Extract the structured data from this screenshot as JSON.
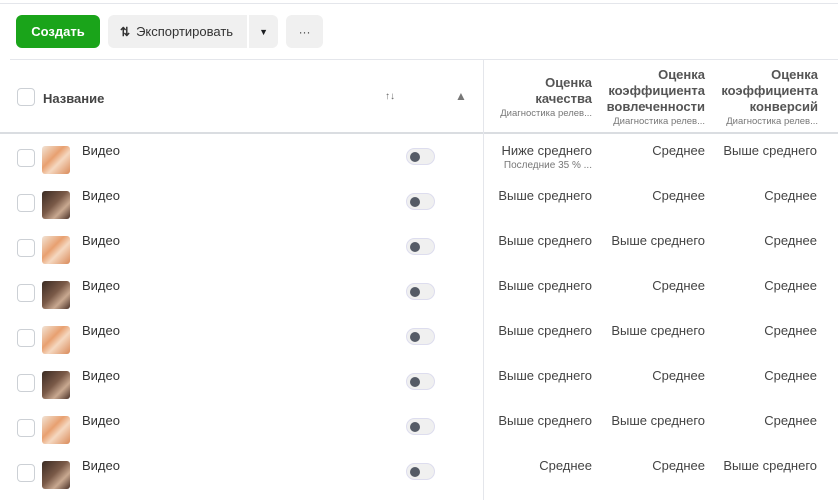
{
  "toolbar": {
    "create_label": "Создать",
    "export_label": "Экспортировать",
    "more_label": "···"
  },
  "colors": {
    "create": "#1aa41a"
  },
  "table": {
    "headers": {
      "name": "Название",
      "quality": {
        "title1": "Оценка",
        "title2": "качества",
        "sub": "Диагностика релев..."
      },
      "engagement": {
        "title1": "Оценка",
        "title2": "коэффициента",
        "title3": "вовлеченности",
        "sub": "Диагностика релев..."
      },
      "conversion": {
        "title1": "Оценка",
        "title2": "коэффициента",
        "title3": "конверсий",
        "sub": "Диагностика релев..."
      }
    },
    "rows": [
      {
        "name": "Видео",
        "thumb": "light",
        "active": false,
        "quality": "Ниже среднего",
        "quality_sub": "Последние 35 % ...",
        "engagement": "Среднее",
        "conversion": "Выше среднего"
      },
      {
        "name": "Видео",
        "thumb": "dark",
        "active": false,
        "quality": "Выше среднего",
        "engagement": "Среднее",
        "conversion": "Среднее"
      },
      {
        "name": "Видео",
        "thumb": "light",
        "active": false,
        "quality": "Выше среднего",
        "engagement": "Выше среднего",
        "conversion": "Среднее"
      },
      {
        "name": "Видео",
        "thumb": "dark",
        "active": false,
        "quality": "Выше среднего",
        "engagement": "Среднее",
        "conversion": "Среднее"
      },
      {
        "name": "Видео",
        "thumb": "light",
        "active": false,
        "quality": "Выше среднего",
        "engagement": "Выше среднего",
        "conversion": "Среднее"
      },
      {
        "name": "Видео",
        "thumb": "dark",
        "active": false,
        "quality": "Выше среднего",
        "engagement": "Среднее",
        "conversion": "Среднее"
      },
      {
        "name": "Видео",
        "thumb": "light",
        "active": false,
        "quality": "Выше среднего",
        "engagement": "Выше среднего",
        "conversion": "Среднее"
      },
      {
        "name": "Видео",
        "thumb": "dark",
        "active": false,
        "quality": "Среднее",
        "engagement": "Среднее",
        "conversion": "Выше среднего"
      }
    ]
  }
}
